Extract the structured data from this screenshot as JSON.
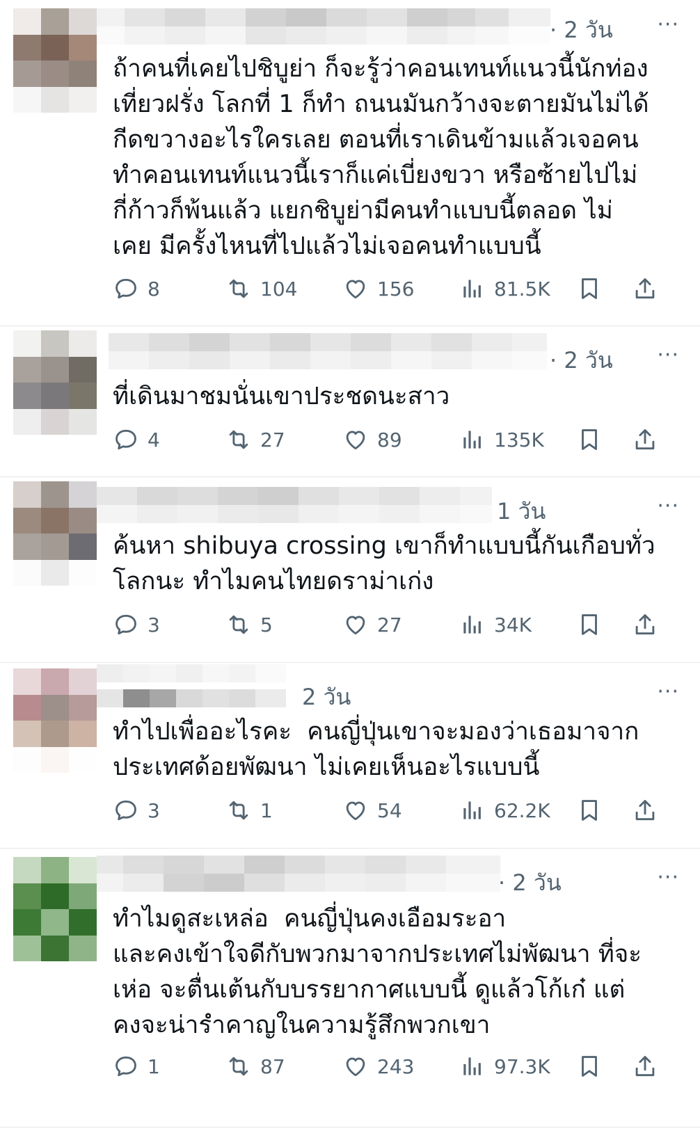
{
  "colors": {
    "text": "#0f1419",
    "muted": "#536471",
    "divider": "#e6e6e6"
  },
  "tweets": [
    {
      "time": "· 2 วัน",
      "more": "···",
      "text": "ถ้าคนที่เคยไปชิบูย่า ก็จะรู้ว่าคอนเทนท์แนวนี้นักท่อง\nเที่ยวฝรั่ง โลกที่ 1 ก็ทำ ถนนมันกว้างจะตายมันไม่ได้\nกีดขวางอะไรใครเลย ตอนที่เราเดินข้ามแล้วเจอคน\nทำคอนเทนท์แนวนี้เราก็แค่เบี่ยงขวา หรือซ้ายไปไม่\nกี่ก้าวก็พ้นแล้ว แยกชิบูย่ามีคนทำแบบนี้ตลอด ไม่\nเคย มีครั้งไหนที่ไปแล้วไม่เจอคนทำแบบนี้",
      "replies": "8",
      "reposts": "104",
      "likes": "156",
      "views": "81.5K"
    },
    {
      "time": "· 2 วัน",
      "more": "···",
      "text": "ที่เดินมาชมนั่นเขาประชดนะสาว",
      "replies": "4",
      "reposts": "27",
      "likes": "89",
      "views": "135K"
    },
    {
      "time": "1 วัน",
      "more": "···",
      "text": "ค้นหา shibuya crossing เขาก็ทำแบบนี้กันเกือบทั่ว\nโลกนะ ทำไมคนไทยดราม่าเก่ง",
      "replies": "3",
      "reposts": "5",
      "likes": "27",
      "views": "34K"
    },
    {
      "time": "2 วัน",
      "more": "···",
      "text": "ทำไปเพื่ออะไรคะ  คนญี่ปุ่นเขาจะมองว่าเธอมาจาก\nประเทศด้อยพัฒนา ไม่เคยเห็นอะไรแบบนี้",
      "replies": "3",
      "reposts": "1",
      "likes": "54",
      "views": "62.2K"
    },
    {
      "time": "· 2 วัน",
      "more": "···",
      "text": "ทำไมดูสะเหล่อ  คนญี่ปุ่นคงเอือมระอา\nและคงเข้าใจดีกับพวกมาจากประเทศไม่พัฒนา ที่จะ\nเห่อ จะตื่นเต้นกับบรรยากาศแบบนี้ ดูแล้วโก้เก๋ แต่\nคงจะน่ารำคาญในความรู้สึกพวกเขา",
      "replies": "1",
      "reposts": "87",
      "likes": "243",
      "views": "97.3K"
    }
  ]
}
